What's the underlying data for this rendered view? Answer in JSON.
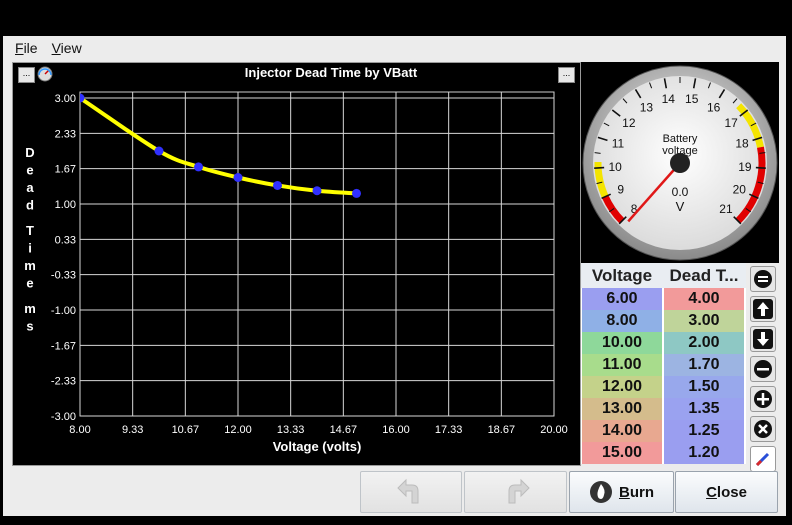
{
  "menu": {
    "file": "File",
    "view": "View"
  },
  "chart_data": {
    "type": "line",
    "title": "Injector Dead Time by VBatt",
    "xlabel": "Voltage (volts)",
    "ylabel": "Dead Time ms",
    "xlim": [
      8.0,
      20.0
    ],
    "ylim": [
      -3.0,
      3.0
    ],
    "x_ticks": [
      "8.00",
      "9.33",
      "10.67",
      "12.00",
      "13.33",
      "14.67",
      "16.00",
      "17.33",
      "18.67",
      "20.00"
    ],
    "y_ticks": [
      "3.00",
      "2.33",
      "1.67",
      "1.00",
      "0.33",
      "-0.33",
      "-1.00",
      "-1.67",
      "-2.33",
      "-3.00"
    ],
    "x": [
      6.0,
      8.0,
      10.0,
      11.0,
      12.0,
      13.0,
      14.0,
      15.0
    ],
    "y": [
      4.0,
      3.0,
      2.0,
      1.7,
      1.5,
      1.35,
      1.25,
      1.2
    ],
    "grid": true,
    "line_color": "#ffff00",
    "point_color": "#3030ff"
  },
  "gauge": {
    "title_line1": "Battery",
    "title_line2": "voltage",
    "value": "0.0",
    "unit": "V",
    "min": 8,
    "max": 21,
    "numeric_value": 0.0,
    "ticks": [
      "8",
      "9",
      "10",
      "11",
      "12",
      "13",
      "14",
      "15",
      "16",
      "17",
      "18",
      "19",
      "20",
      "21"
    ]
  },
  "table": {
    "headers": [
      "Voltage",
      "Dead T..."
    ],
    "rows": [
      {
        "voltage": "6.00",
        "dead": "4.00",
        "c1": "#9a9ef0",
        "c2": "#f29a9a"
      },
      {
        "voltage": "8.00",
        "dead": "3.00",
        "c1": "#8fb0e6",
        "c2": "#bfd49a"
      },
      {
        "voltage": "10.00",
        "dead": "2.00",
        "c1": "#8ed89a",
        "c2": "#8ec8c4"
      },
      {
        "voltage": "11.00",
        "dead": "1.70",
        "c1": "#a8dc8c",
        "c2": "#9cb4e2"
      },
      {
        "voltage": "12.00",
        "dead": "1.50",
        "c1": "#c4d28a",
        "c2": "#98a8ec"
      },
      {
        "voltage": "13.00",
        "dead": "1.35",
        "c1": "#d4bc8c",
        "c2": "#9aa2f0"
      },
      {
        "voltage": "14.00",
        "dead": "1.25",
        "c1": "#e8a890",
        "c2": "#9a9ef0"
      },
      {
        "voltage": "15.00",
        "dead": "1.20",
        "c1": "#f29a9a",
        "c2": "#9a9ef0"
      }
    ]
  },
  "buttons": {
    "burn": "Burn",
    "close": "Close"
  },
  "mini_buttons": {
    "left": "...",
    "right": "..."
  }
}
